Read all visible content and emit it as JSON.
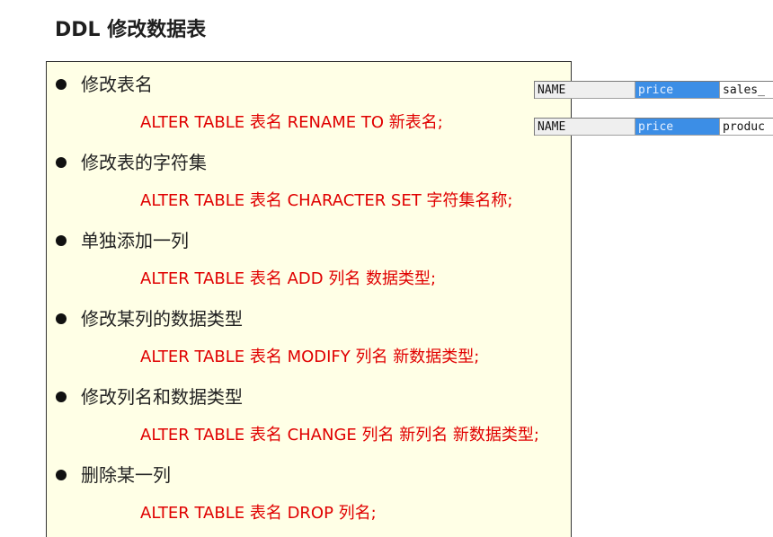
{
  "title": "DDL 修改数据表",
  "items": [
    {
      "label": "修改表名",
      "code": "ALTER TABLE 表名 RENAME TO 新表名;"
    },
    {
      "label": "修改表的字符集",
      "code": "ALTER TABLE 表名 CHARACTER SET 字符集名称;"
    },
    {
      "label": "单独添加一列",
      "code": "ALTER TABLE 表名 ADD 列名 数据类型;"
    },
    {
      "label": "修改某列的数据类型",
      "code": "ALTER TABLE 表名 MODIFY 列名 新数据类型;"
    },
    {
      "label": "修改列名和数据类型",
      "code": "ALTER TABLE 表名 CHANGE 列名 新列名 新数据类型;"
    },
    {
      "label": "删除某一列",
      "code": "ALTER TABLE 表名 DROP 列名;"
    }
  ],
  "side_tables": [
    {
      "cells": [
        "NAME",
        "price",
        "sales_"
      ]
    },
    {
      "cells": [
        "NAME",
        "price",
        "produc"
      ]
    }
  ],
  "colors": {
    "code_text": "#e00000",
    "box_background": "#ffffe6",
    "price_highlight": "#3c8ee6"
  }
}
